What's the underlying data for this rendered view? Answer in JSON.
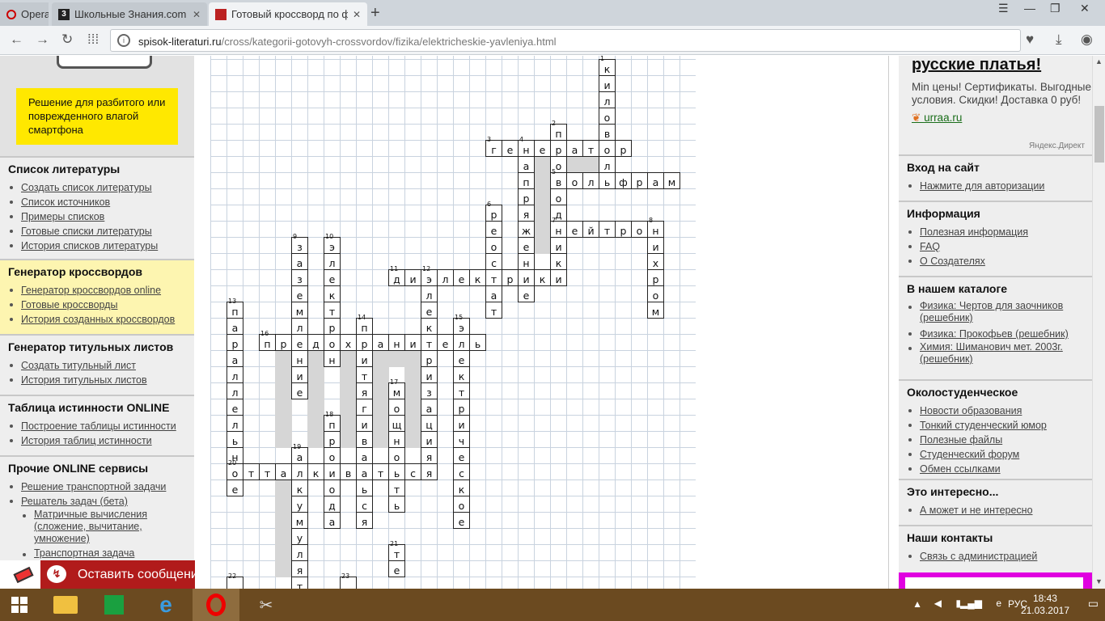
{
  "browser": {
    "opera_tab": "Opera",
    "tabs": [
      {
        "title": "Школьные Знания.com - ",
        "icon": "3"
      },
      {
        "title": "Готовый кроссворд по ф",
        "icon": "book"
      }
    ],
    "url_domain": "spisok-literaturi.ru",
    "url_path": "/cross/kategorii-gotovyh-crossvordov/fizika/elektricheskie-yavleniya.html"
  },
  "promo": {
    "text": "Решение для разбитого или поврежденного влагой смартфона"
  },
  "left_sections": [
    {
      "title": "Список литературы",
      "items": [
        "Создать список литературы",
        "Список источников",
        "Примеры списков",
        "Готовые списки литературы",
        "История списков литературы"
      ]
    },
    {
      "title": "Генератор кроссвордов",
      "items": [
        "Генератор кроссвордов online",
        "Готовые кроссворды",
        "История созданных кроссвордов"
      ]
    },
    {
      "title": "Генератор титульных листов",
      "items": [
        "Создать титульный лист",
        "История титульных листов"
      ]
    },
    {
      "title": "Таблица истинности ONLINE",
      "items": [
        "Построение таблицы истинности",
        "История таблиц истинности"
      ]
    },
    {
      "title": "Прочие ONLINE сервисы",
      "items": [
        "Решение транспортной задачи",
        "Решатель задач (бета)"
      ],
      "subitems": [
        "Матричные вычисления (сложение, вычитание, умножение)",
        "Транспортная задача"
      ]
    }
  ],
  "message_button": "Оставить сообщение",
  "ad": {
    "headline": "русские платья!",
    "text": "Min цены! Сертификаты. Выгодные условия. Скидки! Доставка 0 руб!",
    "link": "urraa.ru",
    "label": "Яндекс.Директ"
  },
  "right_sections": [
    {
      "title": "Вход на сайт",
      "items": [
        "Нажмите для авторизации"
      ]
    },
    {
      "title": "Информация",
      "items": [
        "Полезная информация",
        "FAQ",
        "О Создателях"
      ]
    },
    {
      "title": "В нашем каталоге",
      "items": [
        "Физика: Чертов для заочников (решебник)",
        "Физика: Прокофьев (решебник)",
        "Химия: Шиманович мет. 2003г. (решебник)"
      ]
    },
    {
      "title": "Околостуденческое",
      "items": [
        "Новости образования",
        "Тонкий студенческий юмор",
        "Полезные файлы",
        "Студенческий форум",
        "Обмен ссылками"
      ]
    },
    {
      "title": "Это интересно...",
      "items": [
        "А может и не интересно"
      ]
    },
    {
      "title": "Наши контакты",
      "items": [
        "Связь с администрацией"
      ]
    }
  ],
  "crossword": {
    "words": [
      {
        "n": "1",
        "dir": "down",
        "word": "киловолт"
      },
      {
        "n": "2",
        "dir": "down",
        "word": "проводник"
      },
      {
        "n": "3",
        "dir": "across",
        "word": "генератор"
      },
      {
        "n": "4",
        "dir": "down",
        "word": "напряжение"
      },
      {
        "n": "5",
        "dir": "across",
        "word": "вольфрам"
      },
      {
        "n": "6",
        "dir": "down",
        "word": "реостат"
      },
      {
        "n": "7",
        "dir": "across",
        "word": "нейтрон"
      },
      {
        "n": "8",
        "dir": "down",
        "word": "нихром"
      },
      {
        "n": "9",
        "dir": "down",
        "word": "заземление"
      },
      {
        "n": "10",
        "dir": "down",
        "word": "электрон"
      },
      {
        "n": "11",
        "dir": "across",
        "word": "диэлектрики"
      },
      {
        "n": "12",
        "dir": "down",
        "word": "электризация"
      },
      {
        "n": "13",
        "dir": "down",
        "word": "параллельное"
      },
      {
        "n": "14",
        "dir": "down",
        "word": "притягиваться"
      },
      {
        "n": "15",
        "dir": "down",
        "word": "электрическое"
      },
      {
        "n": "16",
        "dir": "across",
        "word": "предохранитель"
      },
      {
        "n": "17",
        "dir": "down",
        "word": "мощность"
      },
      {
        "n": "18",
        "dir": "down",
        "word": "провода"
      },
      {
        "n": "19",
        "dir": "down",
        "word": "аккумулятор"
      },
      {
        "n": "20",
        "dir": "across",
        "word": "отталкиваться"
      },
      {
        "n": "21",
        "dir": "down",
        "word": "те"
      },
      {
        "n": "22",
        "dir": "down",
        "word": ""
      },
      {
        "n": "23",
        "dir": "down",
        "word": ""
      }
    ]
  },
  "taskbar": {
    "lang": "РУС",
    "time": "18:43",
    "date": "21.03.2017"
  },
  "colors": {
    "promo_yellow": "#ffe800",
    "message_red": "#b11b1b",
    "taskbar": "#6b4a20",
    "ad_link": "#1a6e1a"
  }
}
